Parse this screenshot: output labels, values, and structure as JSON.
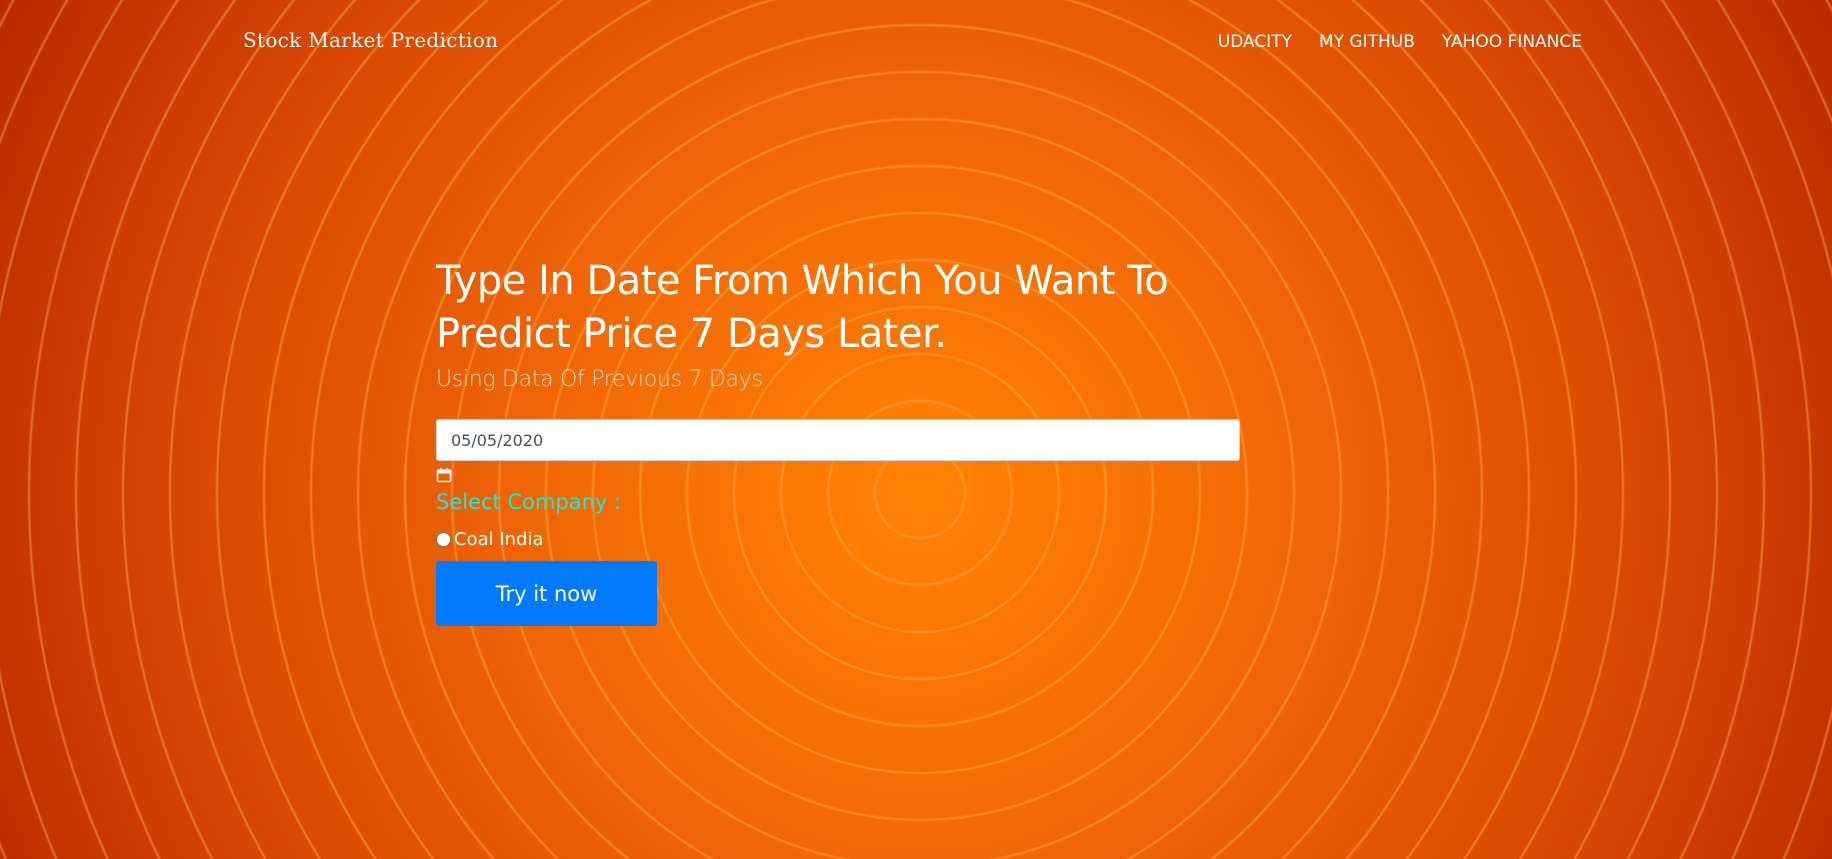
{
  "nav": {
    "brand": "Stock Market Prediction",
    "links": [
      {
        "label": "UDACITY"
      },
      {
        "label": "MY GITHUB"
      },
      {
        "label": "YAHOO FINANCE"
      }
    ]
  },
  "hero": {
    "headline": "Type In Date From Which You Want To Predict Price 7 Days Later.",
    "subheadline": "Using Data Of Previous 7 Days"
  },
  "form": {
    "date_value": "05/05/2020",
    "calendar_icon": "calendar-icon",
    "company_label": "Select Company :",
    "company_option": "Coal India",
    "company_option_selected": false,
    "submit_label": "Try it now"
  },
  "colors": {
    "background_center": "#ff8204",
    "background_edge": "#b82a00",
    "accent_teal": "#24e6d2",
    "button_blue": "#007bff"
  }
}
